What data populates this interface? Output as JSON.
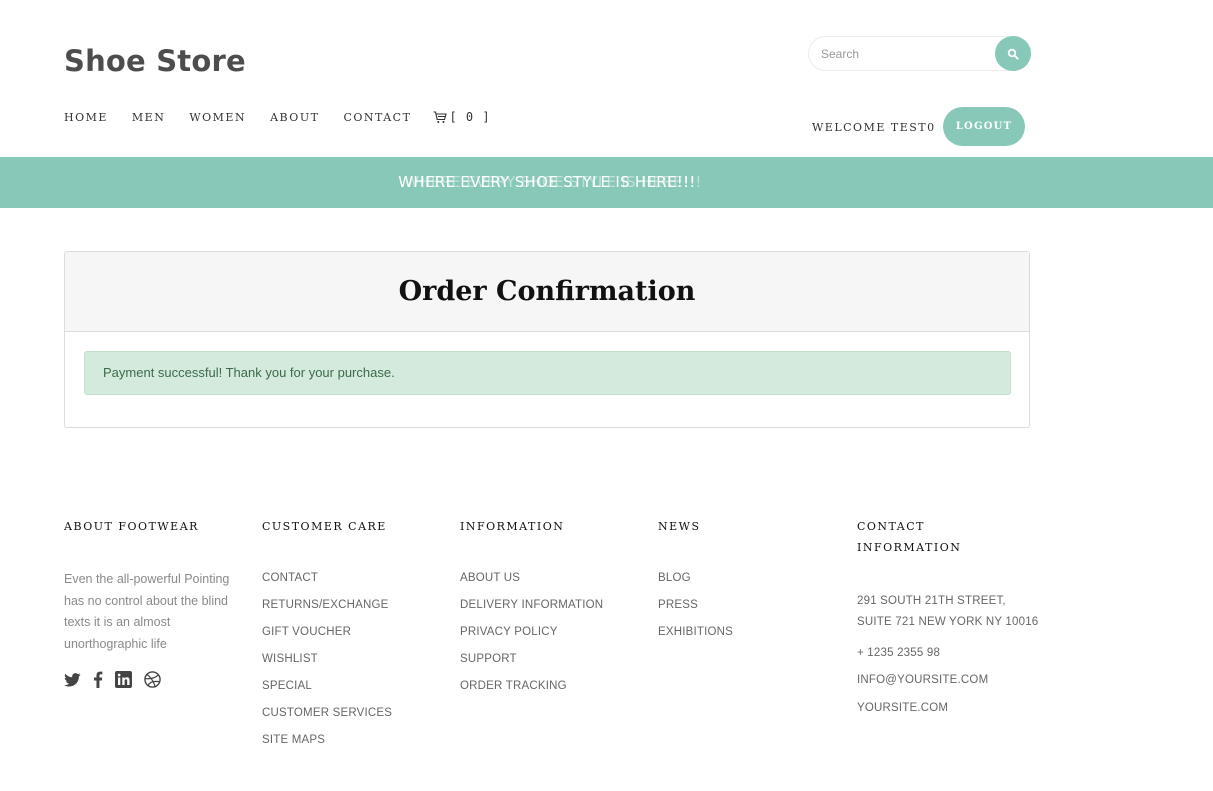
{
  "header": {
    "brand": "Shoe Store",
    "search_placeholder": "Search",
    "nav": [
      "HOME",
      "MEN",
      "WOMEN",
      "ABOUT",
      "CONTACT"
    ],
    "cart_count": "[ 0 ]",
    "welcome": "WELCOME TEST0",
    "logout": "LOGOUT"
  },
  "banner": {
    "text": "WHERE EVERY SHOE STYLE IS HERE!!!"
  },
  "confirmation": {
    "title": "Order Confirmation",
    "message": "Payment successful! Thank you for your purchase."
  },
  "footer": {
    "about": {
      "heading": "ABOUT FOOTWEAR",
      "text": "Even the all-powerful Pointing has no control about the blind texts it is an almost unorthographic life",
      "social": [
        "twitter-icon",
        "facebook-icon",
        "linkedin-icon",
        "dribbble-icon"
      ]
    },
    "customer_care": {
      "heading": "CUSTOMER CARE",
      "links": [
        "CONTACT",
        "RETURNS/EXCHANGE",
        "GIFT VOUCHER",
        "WISHLIST",
        "SPECIAL",
        "CUSTOMER SERVICES",
        "SITE MAPS"
      ]
    },
    "information": {
      "heading": "INFORMATION",
      "links": [
        "ABOUT US",
        "DELIVERY INFORMATION",
        "PRIVACY POLICY",
        "SUPPORT",
        "ORDER TRACKING"
      ]
    },
    "news": {
      "heading": "NEWS",
      "links": [
        "BLOG",
        "PRESS",
        "EXHIBITIONS"
      ]
    },
    "contact": {
      "heading_line1": "CONTACT",
      "heading_line2": "INFORMATION",
      "address_line1": "291 SOUTH 21TH STREET,",
      "address_line2": "SUITE 721 NEW YORK NY 10016",
      "phone": "+ 1235 2355 98",
      "email": "INFO@YOURSITE.COM",
      "website": "YOURSITE.COM"
    }
  },
  "colors": {
    "accent": "#88c8b8",
    "success_bg": "#d4eadc",
    "success_text": "#3c6b4a"
  }
}
